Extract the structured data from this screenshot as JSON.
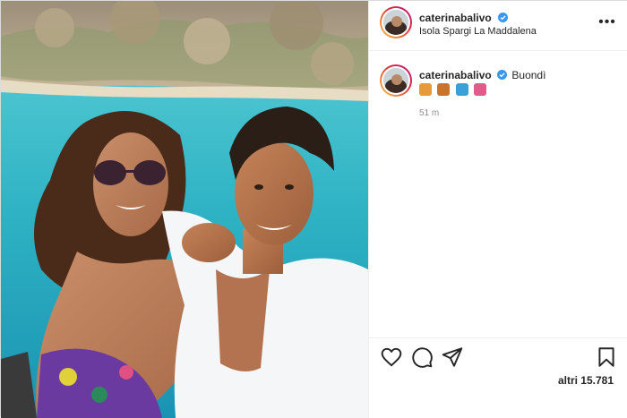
{
  "post": {
    "username": "caterinabalivo",
    "location": "Isola Spargi La Maddalena",
    "caption_username": "caterinabalivo",
    "caption_text": "Buondì",
    "caption_emojis": [
      "emoji-1",
      "emoji-2",
      "emoji-3",
      "emoji-4"
    ],
    "time_ago": "51 m",
    "likes_text": "altri 15.781"
  },
  "icons": {
    "more": "more-options-icon",
    "like": "heart-icon",
    "comment": "comment-icon",
    "share": "share-icon",
    "save": "bookmark-icon",
    "verified": "verified-badge-icon"
  },
  "colors": {
    "verified_blue": "#3897f0",
    "text": "#262626",
    "muted": "#8e8e8e",
    "sea": "#2fb3c4",
    "shirt": "#f4f6f8"
  }
}
